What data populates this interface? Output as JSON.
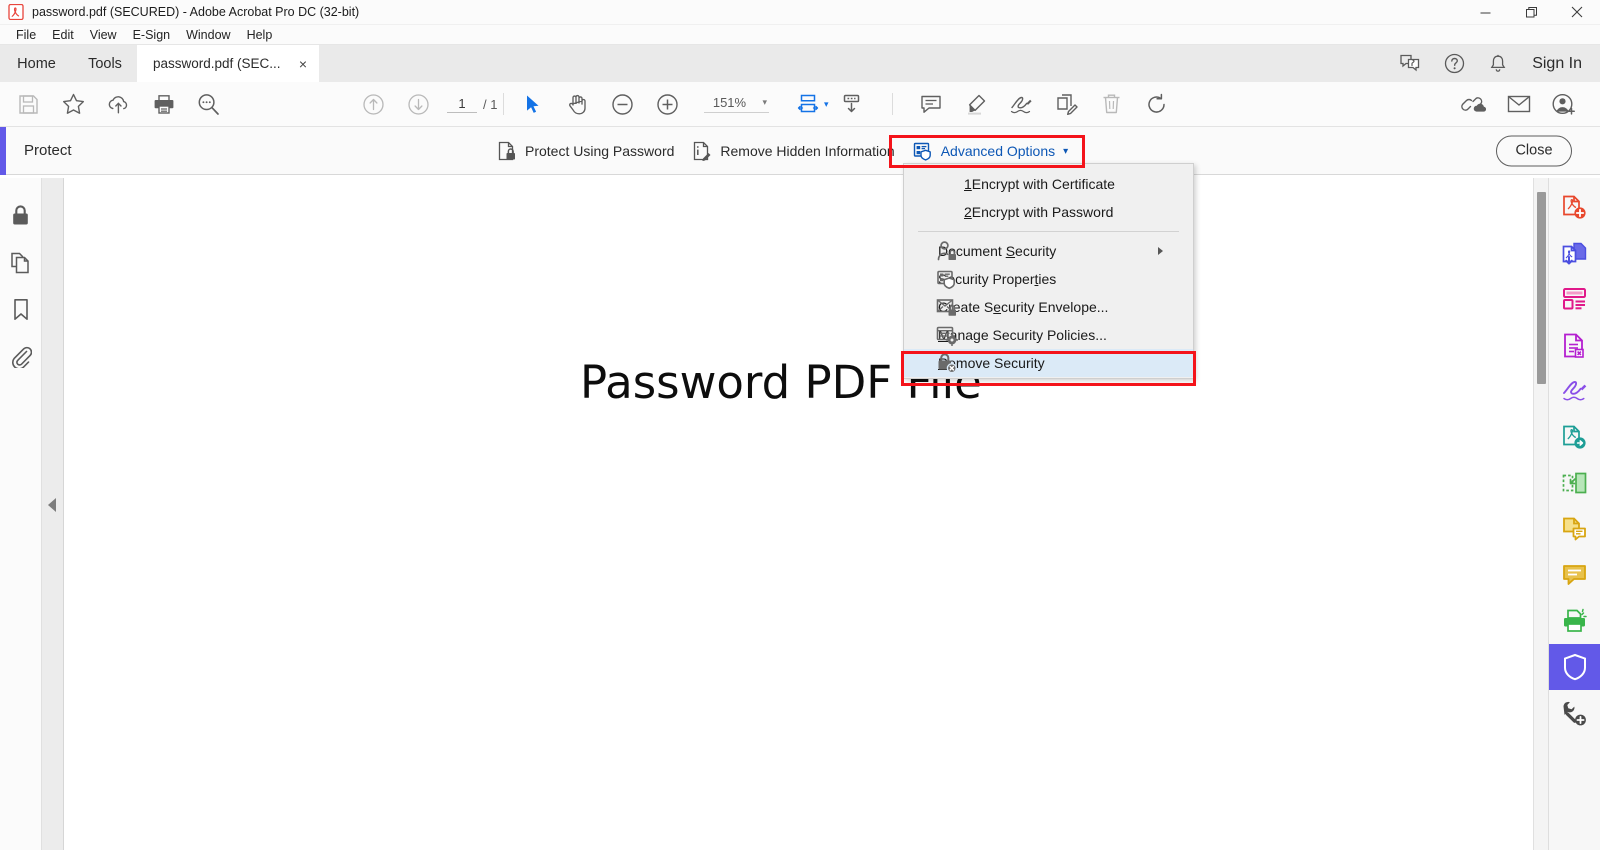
{
  "window": {
    "title": "password.pdf (SECURED) - Adobe Acrobat Pro DC (32-bit)",
    "controls": {
      "minimize": "minimize-icon",
      "restore": "restore-icon",
      "close": "close-icon"
    }
  },
  "menubar": {
    "items": [
      {
        "label": "File",
        "name": "menu-file"
      },
      {
        "label": "Edit",
        "name": "menu-edit"
      },
      {
        "label": "View",
        "name": "menu-view"
      },
      {
        "label": "E-Sign",
        "name": "menu-esign"
      },
      {
        "label": "Window",
        "name": "menu-window"
      },
      {
        "label": "Help",
        "name": "menu-help"
      }
    ]
  },
  "tabbar": {
    "home": "Home",
    "tools": "Tools",
    "document_tab": "password.pdf (SEC...",
    "tab_close": "×",
    "sign_in": "Sign In",
    "icons": [
      "feedback-icon",
      "help-icon",
      "notifications-bell-icon"
    ]
  },
  "toolbar": {
    "left_icons": [
      "save-icon",
      "star-icon",
      "cloud-upload-icon",
      "print-icon",
      "search-icon"
    ],
    "nav_icons": [
      "previous-page-icon",
      "next-page-icon"
    ],
    "page_current": "1",
    "page_total": "/ 1",
    "tool_icons": [
      "select-tool-icon",
      "hand-tool-icon",
      "zoom-out-icon",
      "zoom-in-icon"
    ],
    "zoom_level": "151%",
    "zoom_caret": "▾",
    "fit_icons": [
      "fit-width-icon",
      "fit-page-icon"
    ],
    "annotate_icons": [
      "comment-icon",
      "highlight-icon",
      "sign-icon",
      "edit-pdf-icon",
      "delete-icon",
      "rotate-icon"
    ],
    "right_icons": [
      "share-link-icon",
      "email-icon",
      "add-person-icon"
    ]
  },
  "protectbar": {
    "title": "Protect",
    "accent_color": "#6259e8",
    "buttons": [
      {
        "label": "Protect Using Password",
        "name": "protect-using-password-button",
        "icon": "lock-document-icon",
        "active": false
      },
      {
        "label": "Remove Hidden Information",
        "name": "remove-hidden-information-button",
        "icon": "document-edit-icon",
        "active": false
      },
      {
        "label": "Advanced Options",
        "name": "advanced-options-button",
        "icon": "advanced-security-icon",
        "active": true,
        "caret": "▾"
      }
    ],
    "close_label": "Close"
  },
  "dropdown": {
    "items": [
      {
        "mnemonic": "1",
        "label": " Encrypt with Certificate",
        "name": "menu-encrypt-with-certificate",
        "icon": null,
        "indent": true,
        "highlighted": false
      },
      {
        "mnemonic": "2",
        "label": " Encrypt with Password",
        "name": "menu-encrypt-with-password",
        "icon": null,
        "indent": true,
        "highlighted": false
      },
      {
        "separator": true
      },
      {
        "pre": "Document ",
        "mnemonic": "S",
        "post": "ecurity",
        "name": "menu-document-security",
        "icon": "document-security-icon",
        "submenu": true,
        "highlighted": false
      },
      {
        "pre": "Security Proper",
        "mnemonic": "t",
        "post": "ies",
        "name": "menu-security-properties",
        "icon": "security-properties-icon",
        "highlighted": false
      },
      {
        "pre": "Create S",
        "mnemonic": "e",
        "post": "curity Envelope...",
        "name": "menu-create-security-envelope",
        "icon": "security-envelope-icon",
        "highlighted": false
      },
      {
        "pre": "",
        "mnemonic": "M",
        "post": "anage Security Policies...",
        "name": "menu-manage-security-policies",
        "icon": "manage-policies-icon",
        "highlighted": false
      },
      {
        "pre": "",
        "mnemonic": "R",
        "post": "emove Security",
        "name": "menu-remove-security",
        "icon": "remove-security-icon",
        "highlighted": true
      }
    ]
  },
  "leftrail": {
    "icons": [
      "security-lock-icon",
      "page-thumbnails-icon",
      "bookmarks-icon",
      "attachments-icon"
    ],
    "collapse": "collapse-panel-arrow"
  },
  "document": {
    "heading": "Password PDF File"
  },
  "rightrail": {
    "tools": [
      {
        "name": "tool-create-pdf",
        "color": "#e8472c",
        "selected": false
      },
      {
        "name": "tool-export-pdf",
        "color": "#4b4ee0",
        "selected": false
      },
      {
        "name": "tool-edit-pdf",
        "color": "#e0198a",
        "selected": false
      },
      {
        "name": "tool-organize-pages",
        "color": "#b41fd0",
        "selected": false
      },
      {
        "name": "tool-fill-and-sign",
        "color": "#8a4fe8",
        "selected": false
      },
      {
        "name": "tool-send-for-comments",
        "color": "#1d9e96",
        "selected": false
      },
      {
        "name": "tool-compare-files",
        "color": "#4caf50",
        "selected": false
      },
      {
        "name": "tool-stamp",
        "color": "#d8a511",
        "selected": false
      },
      {
        "name": "tool-comment",
        "color": "#d8a511",
        "selected": false
      },
      {
        "name": "tool-scan-and-ocr",
        "color": "#39b54a",
        "selected": false
      },
      {
        "name": "tool-protect",
        "color": "#ffffff",
        "selected": true
      },
      {
        "name": "tool-more-tools",
        "color": "#4a4a4a",
        "selected": false
      }
    ],
    "selected_bg": "#6259e8"
  },
  "annotations": {
    "color": "#f4131a",
    "boxes": [
      "advanced-options-highlight",
      "remove-security-highlight"
    ]
  }
}
